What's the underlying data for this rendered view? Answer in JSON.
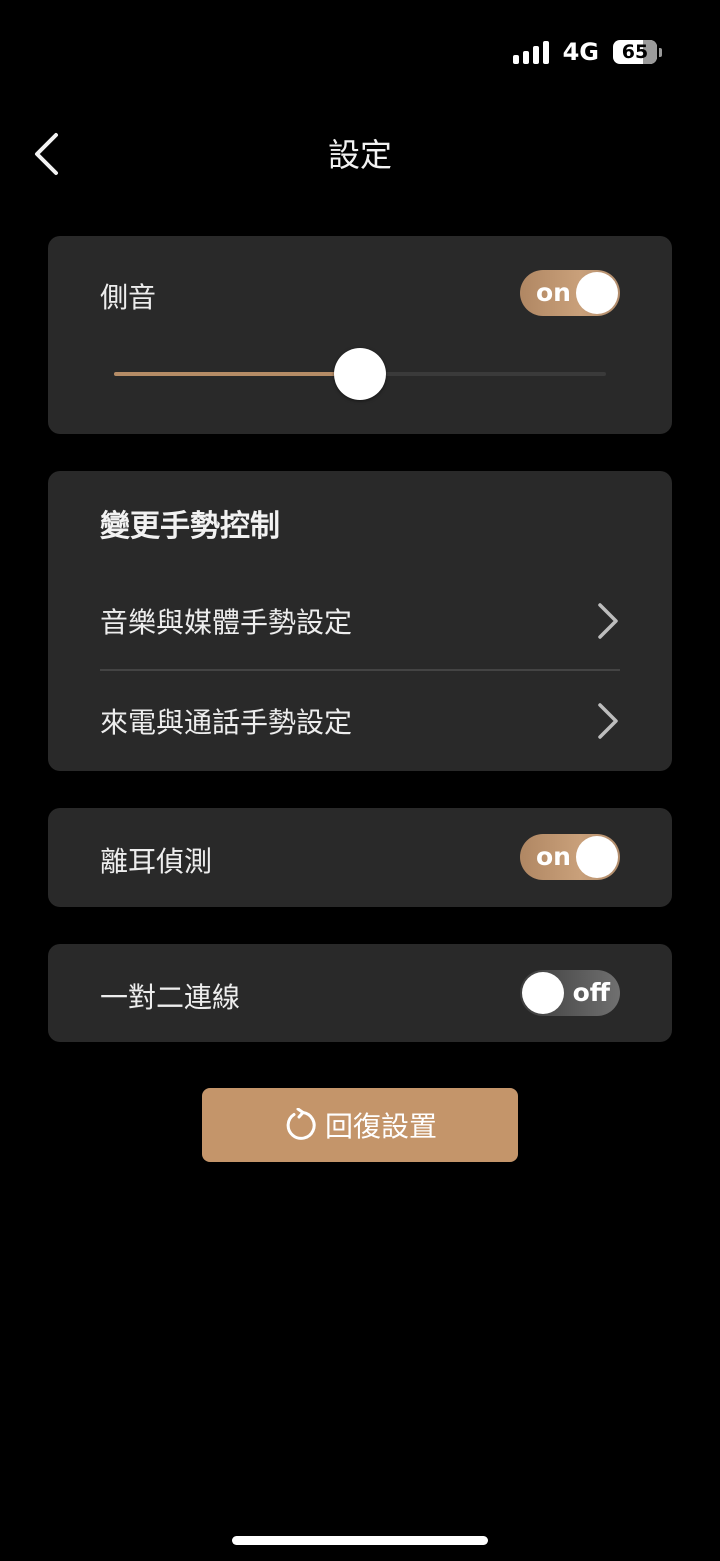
{
  "status_bar": {
    "network": "4G",
    "battery_percent": "65",
    "signal_bars": 4
  },
  "header": {
    "title": "設定"
  },
  "sidetone": {
    "label": "側音",
    "toggle_text": "on",
    "enabled": true,
    "level_fraction": 0.5
  },
  "gesture": {
    "title": "變更手勢控制",
    "items": [
      {
        "label": "音樂與媒體手勢設定"
      },
      {
        "label": "來電與通話手勢設定"
      }
    ]
  },
  "ear_detection": {
    "label": "離耳偵測",
    "toggle_text": "on",
    "enabled": true
  },
  "multipoint": {
    "label": "一對二連線",
    "toggle_text": "off",
    "enabled": false
  },
  "reset": {
    "label": "回復設置"
  },
  "colors": {
    "accent": "#c4956a",
    "card": "#292929",
    "background": "#000000"
  }
}
